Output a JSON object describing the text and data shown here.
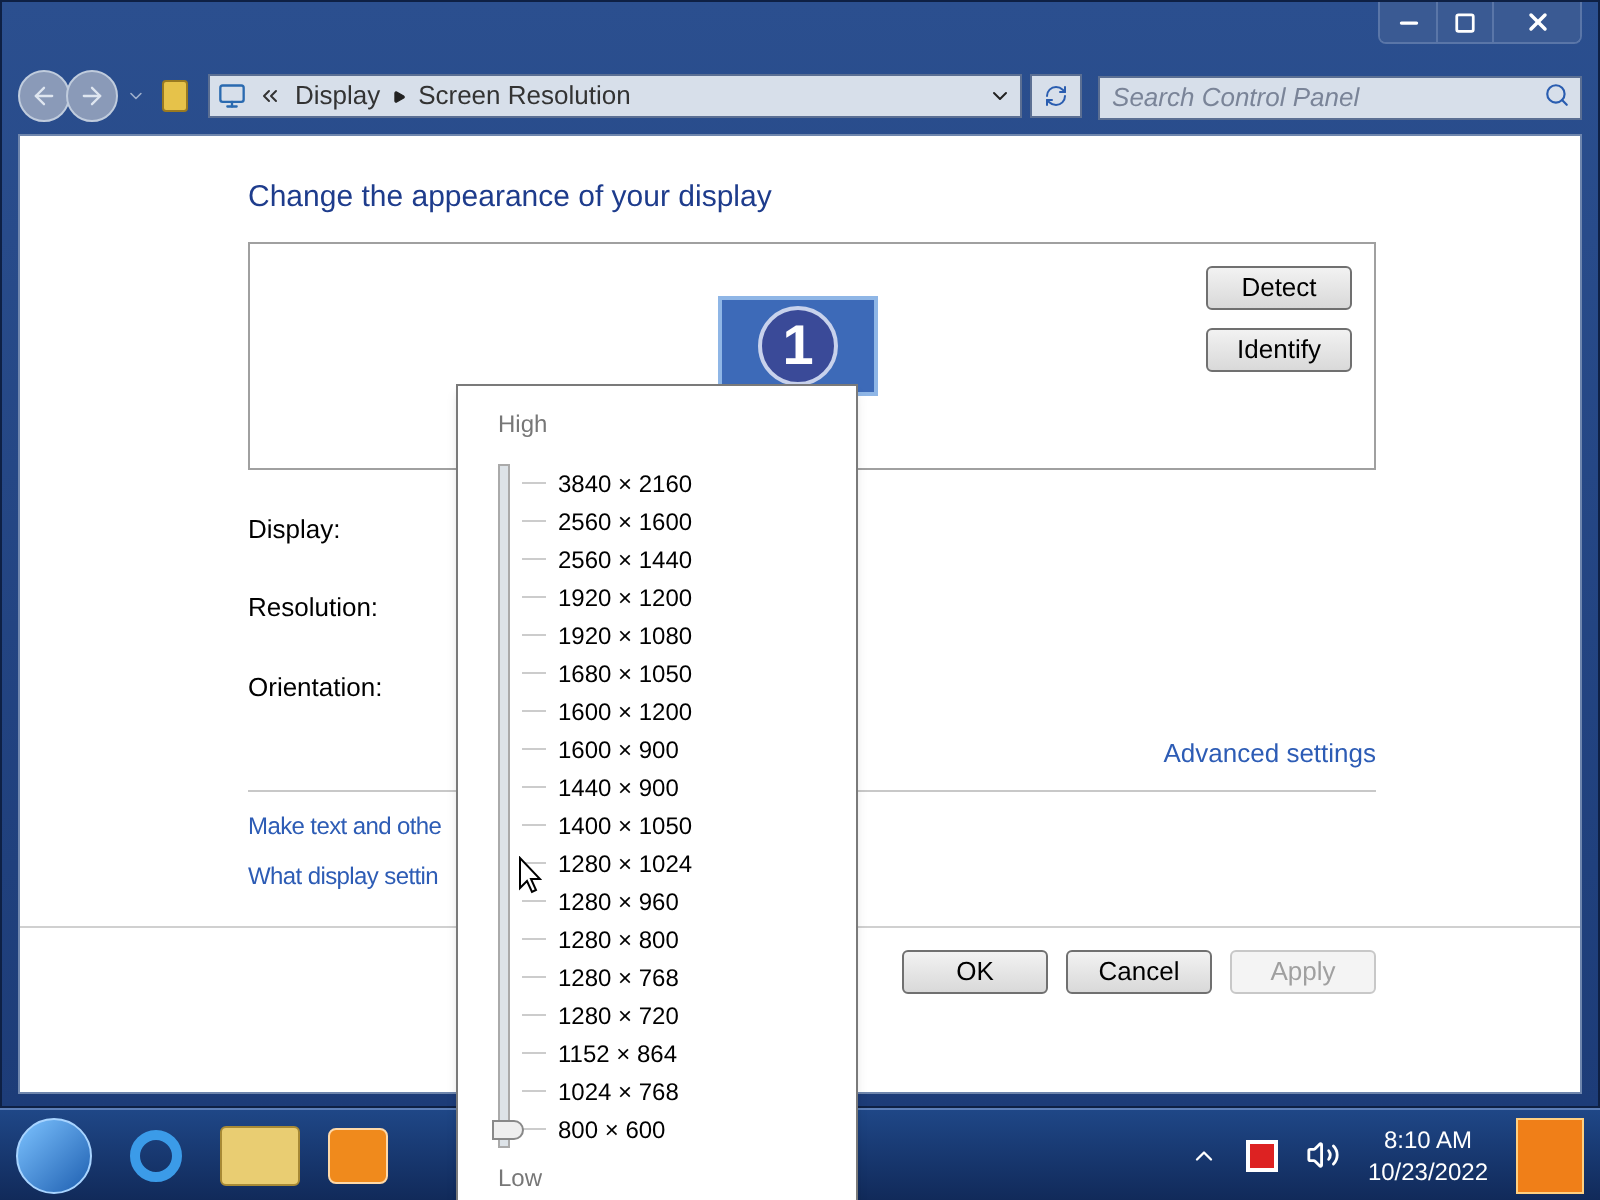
{
  "address_bar": {
    "breadcrumbs": [
      "Display",
      "Screen Resolution"
    ]
  },
  "search": {
    "placeholder": "Search Control Panel"
  },
  "heading": "Change the appearance of your display",
  "preview_buttons": [
    {
      "label": "Detect"
    },
    {
      "label": "Identify"
    }
  ],
  "monitor": {
    "number": "1"
  },
  "settings_labels": [
    "Display:",
    "Resolution:",
    "Orientation:"
  ],
  "advanced_link": "Advanced settings",
  "links": [
    "Make text and othe",
    "What display settin"
  ],
  "dialog_buttons": [
    {
      "label": "OK",
      "disabled": false
    },
    {
      "label": "Cancel",
      "disabled": false
    },
    {
      "label": "Apply",
      "disabled": true
    }
  ],
  "resolution_popup": {
    "high_label": "High",
    "low_label": "Low",
    "level": 0,
    "resolutions": [
      "3840 × 2160",
      "2560 × 1600",
      "2560 × 1440",
      "1920 × 1200",
      "1920 × 1080",
      "1680 × 1050",
      "1600 × 1200",
      "1600 × 900",
      "1440 × 900",
      "1400 × 1050",
      "1280 × 1024",
      "1280 × 960",
      "1280 × 800",
      "1280 × 768",
      "1280 × 720",
      "1152 × 864",
      "1024 × 768",
      "800 × 600"
    ]
  },
  "taskbar": {
    "time": "8:10 AM",
    "date": "10/23/2022"
  }
}
